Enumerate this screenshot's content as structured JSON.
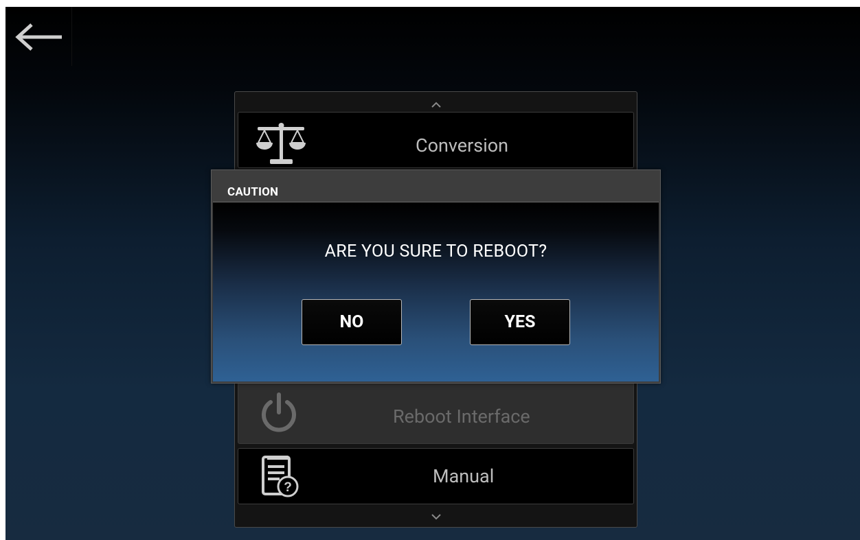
{
  "header": {
    "back_icon": "arrow-left-icon"
  },
  "menu": {
    "scroll_up_icon": "chevron-up-icon",
    "scroll_down_icon": "chevron-down-icon",
    "items": [
      {
        "label": "Conversion",
        "icon": "scale-icon"
      },
      {
        "label": "Reboot Interface",
        "icon": "power-icon"
      },
      {
        "label": "Manual",
        "icon": "manual-help-icon"
      }
    ]
  },
  "dialog": {
    "title": "CAUTION",
    "message": "ARE YOU SURE TO REBOOT?",
    "no_label": "NO",
    "yes_label": "YES"
  },
  "colors": {
    "background_top": "#000000",
    "background_bottom": "#172b40",
    "dialog_frame": "#3d3d3d",
    "dialog_gradient_bottom": "#2f6194",
    "menu_text": "#bdbdbd",
    "disabled_text": "#6a6a6a"
  }
}
